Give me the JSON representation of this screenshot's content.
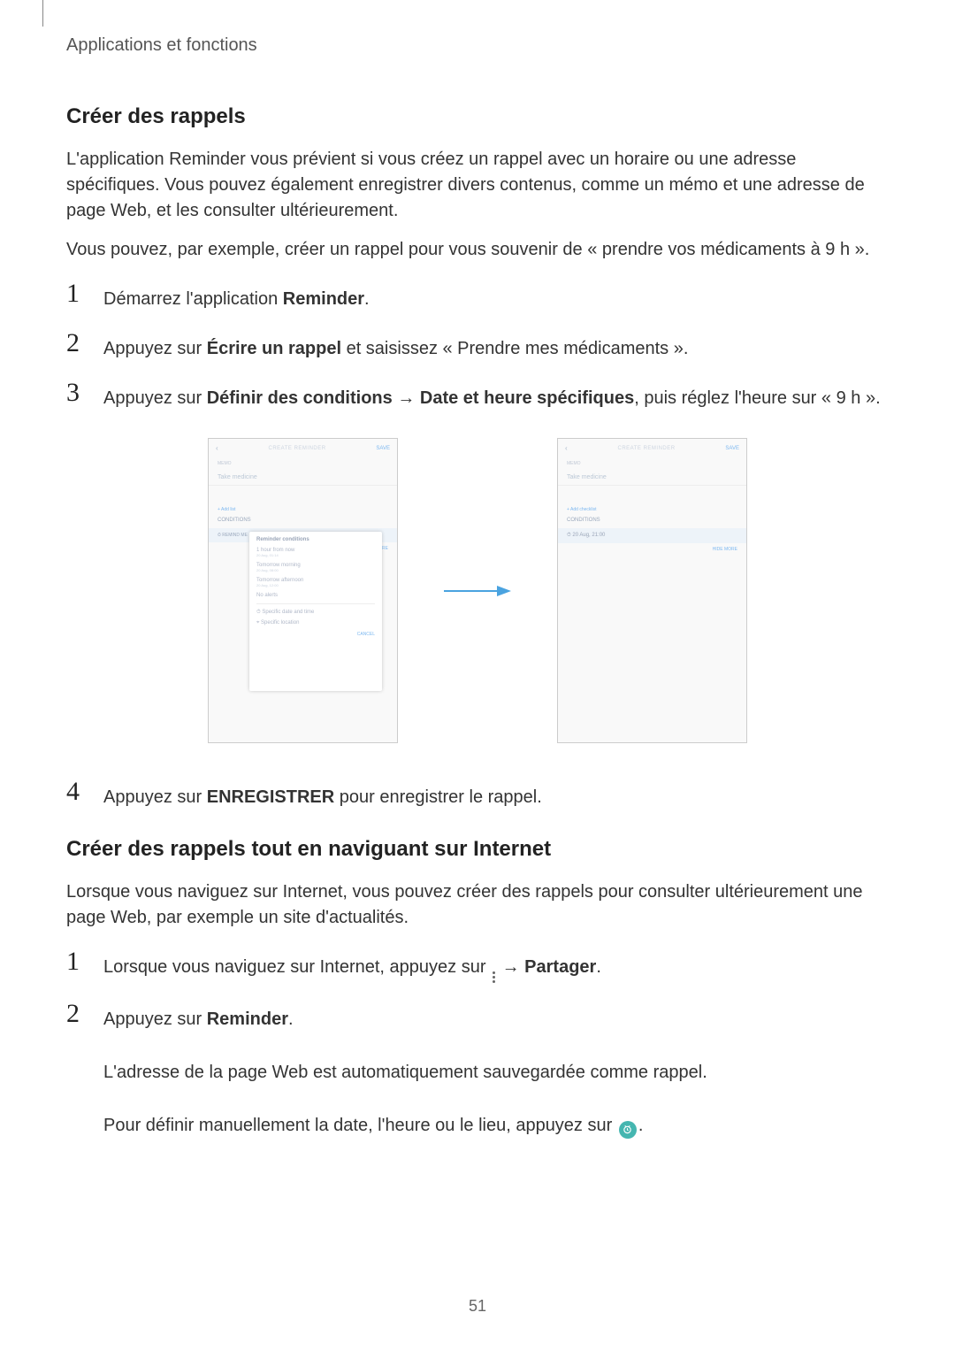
{
  "breadcrumb": "Applications et fonctions",
  "page_number": "51",
  "section1": {
    "title": "Créer des rappels",
    "p1": "L'application Reminder vous prévient si vous créez un rappel avec un horaire ou une adresse spécifiques. Vous pouvez également enregistrer divers contenus, comme un mémo et une adresse de page Web, et les consulter ultérieurement.",
    "p2": "Vous pouvez, par exemple, créer un rappel pour vous souvenir de « prendre vos médicaments à 9 h ».",
    "steps": {
      "s1_a": "Démarrez l'application ",
      "s1_b": "Reminder",
      "s1_c": ".",
      "s2_a": "Appuyez sur ",
      "s2_b": "Écrire un rappel",
      "s2_c": " et saisissez « Prendre mes médicaments ».",
      "s3_a": "Appuyez sur ",
      "s3_b": "Définir des conditions",
      "s3_c": " → ",
      "s3_d": "Date et heure spécifiques",
      "s3_e": ", puis réglez l'heure sur « 9 h ».",
      "s4_a": "Appuyez sur ",
      "s4_b": "ENREGISTRER",
      "s4_c": " pour enregistrer le rappel."
    }
  },
  "section2": {
    "title": "Créer des rappels tout en naviguant sur Internet",
    "p1": "Lorsque vous naviguez sur Internet, vous pouvez créer des rappels pour consulter ultérieurement une page Web, par exemple un site d'actualités.",
    "steps": {
      "s1_a": "Lorsque vous naviguez sur Internet, appuyez sur ",
      "s1_b": " → ",
      "s1_c": "Partager",
      "s1_d": ".",
      "s2_a": "Appuyez sur ",
      "s2_b": "Reminder",
      "s2_c": ".",
      "s2_p1": "L'adresse de la page Web est automatiquement sauvegardée comme rappel.",
      "s2_p2a": "Pour définir manuellement la date, l'heure ou le lieu, appuyez sur ",
      "s2_p2b": "."
    }
  },
  "mockup": {
    "left": {
      "back": "‹",
      "title": "CREATE REMINDER",
      "save": "SAVE",
      "memo": "MEMO",
      "reminder_text": "Take medicine",
      "sidebar_label": "+ Add list",
      "conditions_label": "CONDITIONS",
      "remind_me": "REMIND ME",
      "popup_header": "Reminder conditions",
      "opt1": "1 hour from now",
      "opt1_sub": "20 Aug, 01:14",
      "opt2": "Tomorrow morning",
      "opt2_sub": "20 Aug, 08:00",
      "opt3": "Tomorrow afternoon",
      "opt3_sub": "20 Aug, 12:00",
      "opt4": "No alerts",
      "opt5": "Specific date and time",
      "opt6": "Specific location",
      "cancel": "CANCEL",
      "hide": "HIDE MORE"
    },
    "right": {
      "back": "‹",
      "title": "CREATE REMINDER",
      "save": "SAVE",
      "memo": "MEMO",
      "reminder_text": "Take medicine",
      "sidebar_label": "+ Add checklist",
      "conditions_label": "CONDITIONS",
      "date_row": "20 Aug, 21:00",
      "hide": "HIDE MORE"
    }
  }
}
